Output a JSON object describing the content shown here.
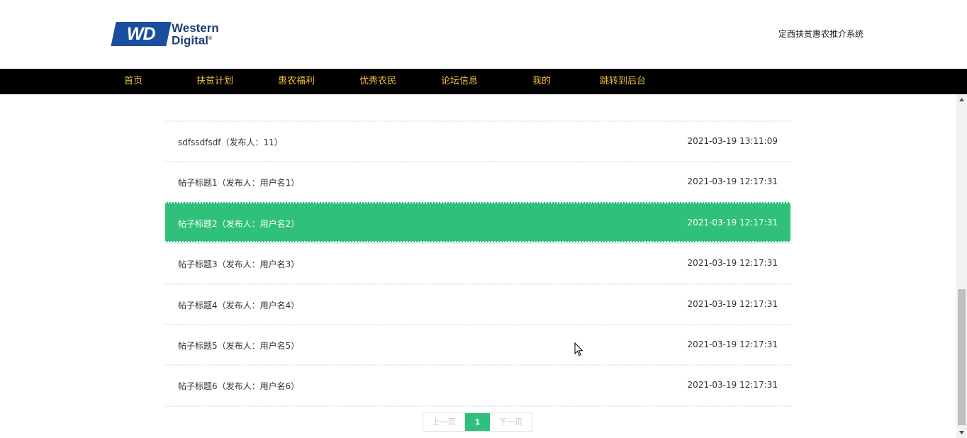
{
  "header": {
    "logo": {
      "badge": "WD",
      "line1": "Western",
      "line2": "Digital",
      "mark": "®"
    },
    "site_title": "定西扶贫惠农推介系统"
  },
  "nav": {
    "items": [
      {
        "label": "首页"
      },
      {
        "label": "扶贫计划"
      },
      {
        "label": "惠农福利"
      },
      {
        "label": "优秀农民"
      },
      {
        "label": "论坛信息"
      },
      {
        "label": "我的"
      },
      {
        "label": "跳转到后台"
      }
    ]
  },
  "posts": [
    {
      "title": "sdfssdfsdf（发布人：11）",
      "time": "2021-03-19 13:11:09",
      "active": false
    },
    {
      "title": "帖子标题1（发布人：用户名1）",
      "time": "2021-03-19 12:17:31",
      "active": false
    },
    {
      "title": "帖子标题2（发布人：用户名2）",
      "time": "2021-03-19 12:17:31",
      "active": true
    },
    {
      "title": "帖子标题3（发布人：用户名3）",
      "time": "2021-03-19 12:17:31",
      "active": false
    },
    {
      "title": "帖子标题4（发布人：用户名4）",
      "time": "2021-03-19 12:17:31",
      "active": false
    },
    {
      "title": "帖子标题5（发布人：用户名5）",
      "time": "2021-03-19 12:17:31",
      "active": false
    },
    {
      "title": "帖子标题6（发布人：用户名6）",
      "time": "2021-03-19 12:17:31",
      "active": false
    }
  ],
  "pagination": {
    "prev_label": "上一页",
    "current_page": "1",
    "next_label": "下一页"
  },
  "colors": {
    "accent": "#2fc07c",
    "nav_bg": "#000000",
    "nav_text": "#f0c040",
    "logo_blue": "#1a4fa0"
  },
  "icons": {
    "scroll_up": "triangle-up",
    "scroll_down": "triangle-down",
    "cursor": "arrow-pointer"
  }
}
